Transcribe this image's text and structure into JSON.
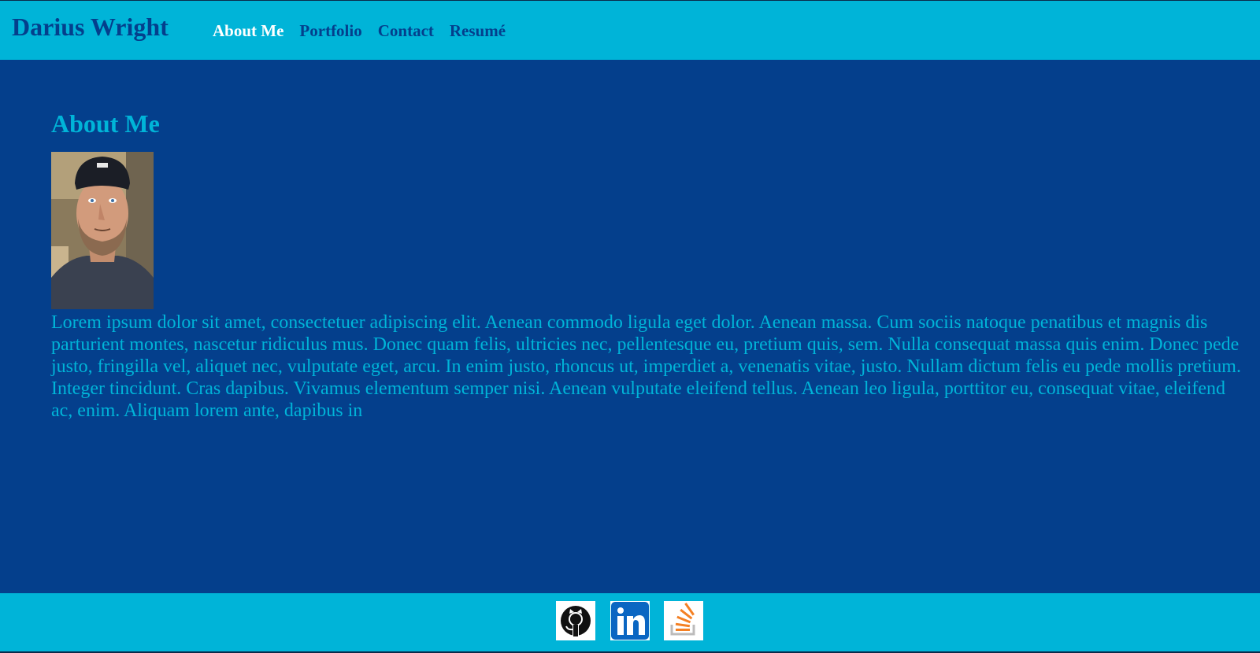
{
  "header": {
    "brand": "Darius Wright",
    "nav": [
      {
        "label": "About Me",
        "active": true
      },
      {
        "label": "Portfolio",
        "active": false
      },
      {
        "label": "Contact",
        "active": false
      },
      {
        "label": "Resumé",
        "active": false
      }
    ]
  },
  "main": {
    "title": "About Me",
    "bio": "Lorem ipsum dolor sit amet, consectetuer adipiscing elit. Aenean commodo ligula eget dolor. Aenean massa. Cum sociis natoque penatibus et magnis dis parturient montes, nascetur ridiculus mus. Donec quam felis, ultricies nec, pellentesque eu, pretium quis, sem. Nulla consequat massa quis enim. Donec pede justo, fringilla vel, aliquet nec, vulputate eget, arcu. In enim justo, rhoncus ut, imperdiet a, venenatis vitae, justo. Nullam dictum felis eu pede mollis pretium. Integer tincidunt. Cras dapibus. Vivamus elementum semper nisi. Aenean vulputate eleifend tellus. Aenean leo ligula, porttitor eu, consequat vitae, eleifend ac, enim. Aliquam lorem ante, dapibus in"
  },
  "footer": {
    "social": [
      {
        "icon": "github-icon"
      },
      {
        "icon": "linkedin-icon"
      },
      {
        "icon": "stackoverflow-icon"
      }
    ]
  },
  "colors": {
    "page_background": "#043f8c",
    "header_background": "#00b4d8",
    "brand_text": "#043f8c",
    "active_nav": "#ffffff",
    "accent_text": "#00b4d8",
    "linkedin_blue": "#0a66c2",
    "stackoverflow_orange": "#f48024"
  }
}
